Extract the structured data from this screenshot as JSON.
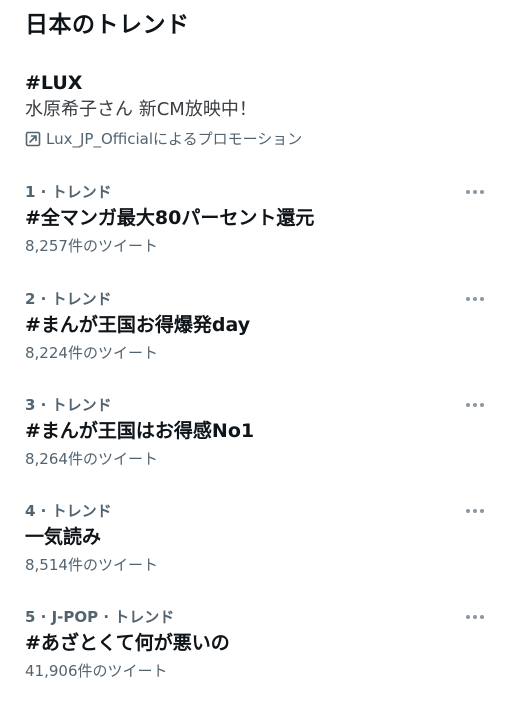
{
  "header": {
    "title": "日本のトレンド"
  },
  "promoted": {
    "hashtag": "#LUX",
    "text": "水原希子さん 新CM放映中！",
    "promoted_by": "Lux_JP_Officialによるプロモーション",
    "icon": "promoted-arrow-icon"
  },
  "trends": [
    {
      "meta": "1 · トレンド",
      "name": "#全マンガ最大80パーセント還元",
      "count": "8,257件のツイート"
    },
    {
      "meta": "2 · トレンド",
      "name": "#まんが王国お得爆発day",
      "count": "8,224件のツイート"
    },
    {
      "meta": "3 · トレンド",
      "name": "#まんが王国はお得感No1",
      "count": "8,264件のツイート"
    },
    {
      "meta": "4 · トレンド",
      "name": "一気読み",
      "count": "8,514件のツイート"
    },
    {
      "meta": "5 · J-POP · トレンド",
      "name": "#あざとくて何が悪いの",
      "count": "41,906件のツイート"
    }
  ],
  "colors": {
    "text_primary": "#0f1419",
    "text_secondary": "#536471",
    "background": "#ffffff"
  }
}
